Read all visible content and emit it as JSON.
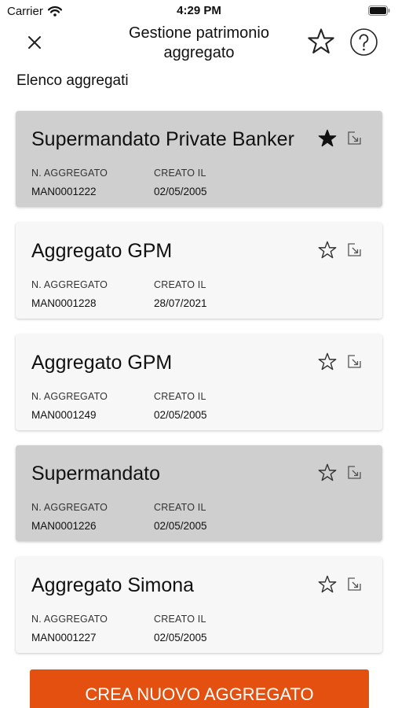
{
  "status_bar": {
    "carrier": "Carrier",
    "time": "4:29 PM"
  },
  "header": {
    "title": "Gestione patrimonio aggregato"
  },
  "section_label": "Elenco aggregati",
  "field_labels": {
    "number": "N. AGGREGATO",
    "created": "CREATO IL"
  },
  "cards": [
    {
      "title": "Supermandato Private Banker",
      "number": "MAN0001222",
      "created": "02/05/2005",
      "favorite": true
    },
    {
      "title": "Aggregato GPM",
      "number": "MAN0001228",
      "created": "28/07/2021",
      "favorite": false
    },
    {
      "title": "Aggregato GPM",
      "number": "MAN0001249",
      "created": "02/05/2005",
      "favorite": false
    },
    {
      "title": "Supermandato",
      "number": "MAN0001226",
      "created": "02/05/2005",
      "favorite": false
    },
    {
      "title": "Aggregato Simona",
      "number": "MAN0001227",
      "created": "02/05/2005",
      "favorite": false
    }
  ],
  "create_button": {
    "label": "CREA NUOVO AGGREGATO"
  },
  "colors": {
    "accent": "#e4500f",
    "card_selected": "#cfcfcf",
    "card_default": "#f7f7f7"
  },
  "icons": {
    "close": "close-icon",
    "favorite": "star-icon",
    "help": "help-icon",
    "open": "open-icon"
  }
}
